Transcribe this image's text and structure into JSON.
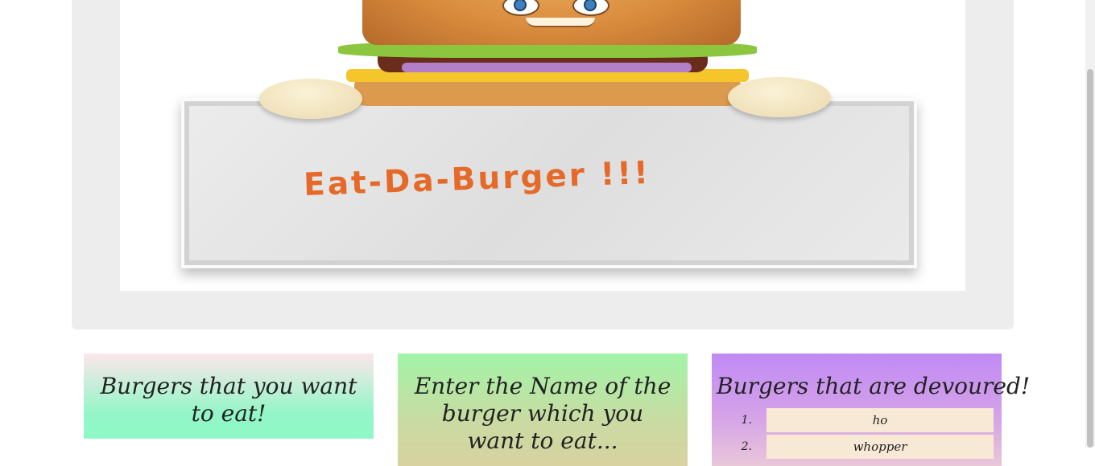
{
  "banner": {
    "sign_text": "Eat-Da-Burger !!!"
  },
  "cards": {
    "want_to_eat": {
      "title": "Burgers that you want to eat!"
    },
    "enter_name": {
      "title": "Enter the Name of the burger which you want to eat..."
    },
    "devoured": {
      "title": "Burgers that are devoured!",
      "items": [
        {
          "num": "1.",
          "name": "ho"
        },
        {
          "num": "2.",
          "name": "whopper"
        }
      ]
    }
  },
  "colors": {
    "sign_text": "#e56a2a",
    "card_want": "#8df8c6",
    "card_enter": "#a2f4a8",
    "card_devoured": "#c08af5",
    "list_item_bg": "#f8e8d6"
  }
}
